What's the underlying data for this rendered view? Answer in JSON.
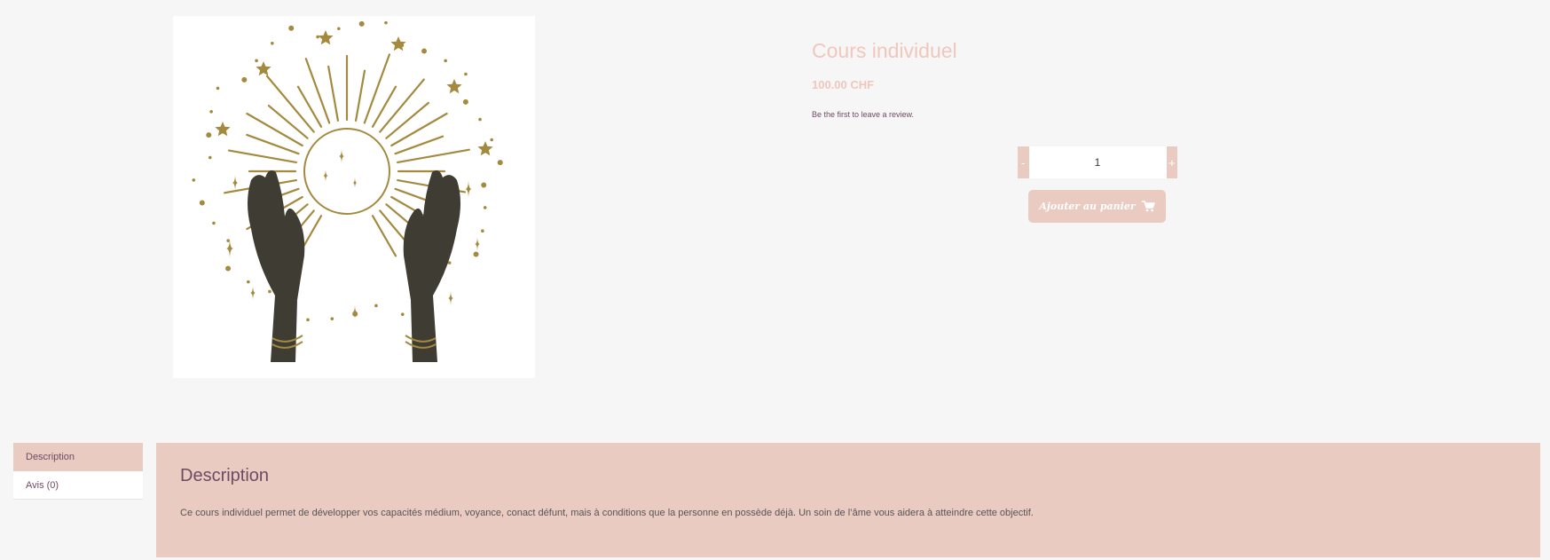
{
  "product": {
    "title": "Cours individuel",
    "price": "100.00 CHF",
    "review_link": "Be the first to leave a review.",
    "image_name": "moon-hands-illustration"
  },
  "quantity": {
    "minus_label": "-",
    "plus_label": "+",
    "value": "1"
  },
  "cart": {
    "button_label": "Ajouter au panier",
    "icon": "cart-icon"
  },
  "tabs": [
    {
      "label": "Description",
      "active": true
    },
    {
      "label": "Avis (0)",
      "active": false
    }
  ],
  "description": {
    "heading": "Description",
    "text": "Ce cours individuel permet de développer vos capacités médium, voyance, conact défunt, mais à conditions que la personne en possède déjà. Un soin de l’âme vous aidera à atteindre cette objectif."
  },
  "colors": {
    "accent": "#eacbc2",
    "title": "#efc7bd",
    "text_purple": "#6e4b63",
    "gold": "#a48a3e",
    "hands": "#3f3d33"
  }
}
